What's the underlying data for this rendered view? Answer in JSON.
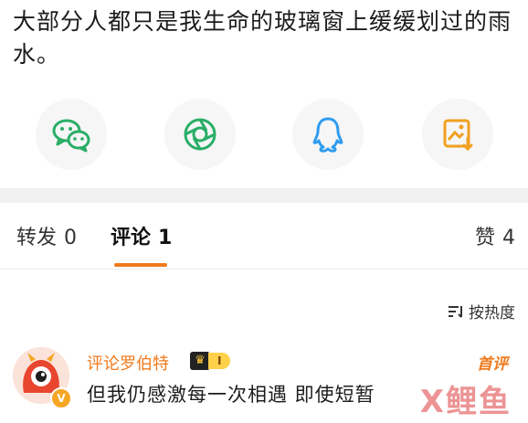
{
  "post": {
    "text": "大部分人都只是我生命的玻璃窗上缓缓划过的雨水。"
  },
  "share": {
    "items": [
      {
        "icon": "wechat-icon",
        "color": "#2aae67"
      },
      {
        "icon": "moments-icon",
        "color": "#2aae67"
      },
      {
        "icon": "qq-icon",
        "color": "#2f9cf0"
      },
      {
        "icon": "save-image-icon",
        "color": "#f0a020"
      }
    ]
  },
  "tabs": {
    "repost_label": "转发",
    "repost_count": "0",
    "comment_label": "评论",
    "comment_count": "1",
    "like_label": "赞",
    "like_count": "4",
    "accent": "#f07a1d"
  },
  "sort": {
    "label": "按热度"
  },
  "comment": {
    "username": "评论罗伯特",
    "level": "I",
    "tag": "首评",
    "text": "但我仍感激每一次相遇 即使短暂"
  },
  "watermark": {
    "text": "X鲤鱼"
  }
}
